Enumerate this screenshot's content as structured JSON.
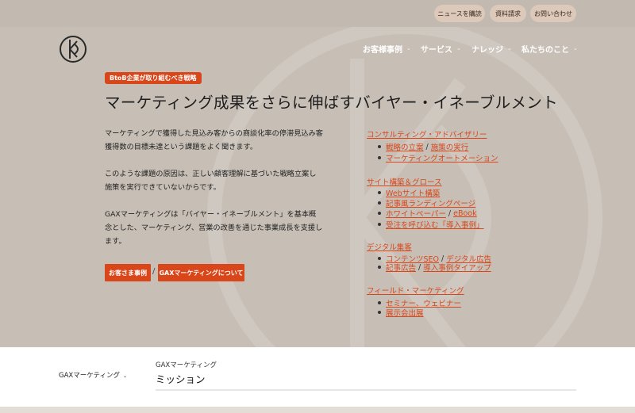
{
  "topbar": {
    "news_label": "ニュースを購読",
    "request_label": "資料請求",
    "contact_label": "お問い合わせ"
  },
  "nav": {
    "items": [
      {
        "label": "お客様事例"
      },
      {
        "label": "サービス"
      },
      {
        "label": "ナレッジ"
      },
      {
        "label": "私たちのこと"
      }
    ]
  },
  "hero": {
    "tag": "BtoB企業が取り組むべき戦略",
    "headline": "マーケティング成果をさらに伸ばすバイヤー・イネーブルメント",
    "paragraphs": [
      "マーケティングで獲得した見込み客からの商談化率の停滞見込み客獲得数の目標未達という課題をよく聞きます。",
      "このような課題の原因は、正しい顧客理解に基づいた戦略立案し施策を実行できていないからです。",
      "GAXマーケティングは「バイヤー・イネーブルメント」を基本概念とした、マーケティング、営業の改善を通じた事業成長を支援します。"
    ],
    "button_cases": "お客さま事例",
    "separator": "/",
    "button_about": "GAXマーケティングについて"
  },
  "services": {
    "consulting": {
      "title": "コンサルティング・アドバイザリー",
      "item1_a": "戦略の立案",
      "item1_b": "施策の実行",
      "item2": "マーケティングオートメーション"
    },
    "site": {
      "title": "サイト構築＆グロース",
      "item1": "Webサイト構築",
      "item2": "記事風ランディングページ",
      "item3_a": "ホワイトペーパー",
      "item3_b": "eBook",
      "item4": "受注を呼び込む「導入事例」"
    },
    "digital": {
      "title": "デジタル集客",
      "item1_a": "コンテンツSEO",
      "item1_b": "デジタル広告",
      "item2_a": "記事広告",
      "item2_b": "導入事例タイアップ"
    },
    "field": {
      "title": "フィールド・マーケティング",
      "item1": "セミナー、ウェビナー",
      "item2": "展示会出展"
    },
    "sep": "/"
  },
  "bottom": {
    "crumb": "GAXマーケティング",
    "small_title": "GAXマーケティング",
    "mission": "ミッション"
  },
  "colors": {
    "accent": "#d9461a",
    "hero_bg": "#c7bfb6"
  }
}
